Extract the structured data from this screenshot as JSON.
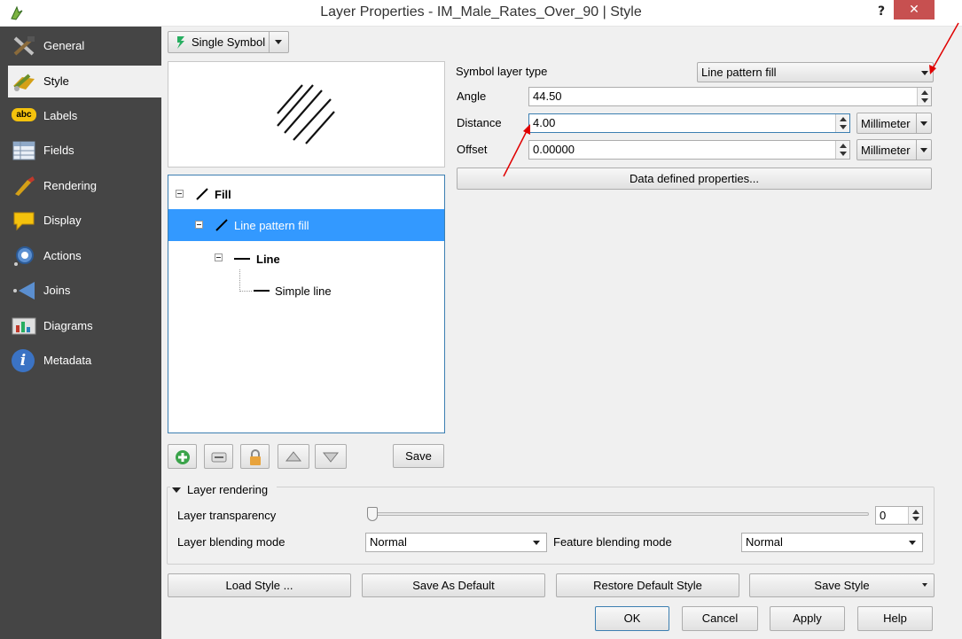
{
  "window": {
    "title": "Layer Properties - IM_Male_Rates_Over_90 | Style",
    "help": "?",
    "close": "✕"
  },
  "sidebar": {
    "items": [
      {
        "label": "General",
        "icon": "general-icon"
      },
      {
        "label": "Style",
        "icon": "style-icon"
      },
      {
        "label": "Labels",
        "icon": "labels-icon",
        "icon_text": "abc"
      },
      {
        "label": "Fields",
        "icon": "fields-icon"
      },
      {
        "label": "Rendering",
        "icon": "rendering-icon"
      },
      {
        "label": "Display",
        "icon": "display-icon"
      },
      {
        "label": "Actions",
        "icon": "actions-icon"
      },
      {
        "label": "Joins",
        "icon": "joins-icon"
      },
      {
        "label": "Diagrams",
        "icon": "diagrams-icon"
      },
      {
        "label": "Metadata",
        "icon": "metadata-icon",
        "icon_text": "i"
      }
    ],
    "active": "Style"
  },
  "renderer": {
    "label": "Single Symbol"
  },
  "symbol": {
    "layer_type_label": "Symbol layer type",
    "layer_type_value": "Line pattern fill",
    "angle_label": "Angle",
    "angle_value": "44.50",
    "distance_label": "Distance",
    "distance_value": "4.00",
    "distance_unit": "Millimeter",
    "offset_label": "Offset",
    "offset_value": "0.00000",
    "offset_unit": "Millimeter",
    "data_defined": "Data defined properties..."
  },
  "tree": {
    "fill": "Fill",
    "line_pattern_fill": "Line pattern fill",
    "line": "Line",
    "simple_line": "Simple line"
  },
  "symbol_buttons": {
    "save": "Save"
  },
  "layer_rendering": {
    "header": "Layer rendering",
    "transparency_label": "Layer transparency",
    "transparency_value": "0",
    "transparency_fraction": 0,
    "blending_label": "Layer blending mode",
    "blending_value": "Normal",
    "feature_blending_label": "Feature blending mode",
    "feature_blending_value": "Normal"
  },
  "bottom": {
    "load_style": "Load Style ...",
    "save_default": "Save As Default",
    "restore_default": "Restore Default Style",
    "save_style": "Save Style",
    "ok": "OK",
    "cancel": "Cancel",
    "apply": "Apply",
    "help": "Help"
  },
  "colors": {
    "sidebar_bg": "#454545",
    "selection": "#3399ff",
    "annotation_arrow": "#e00000",
    "close_bg": "#c75050"
  }
}
